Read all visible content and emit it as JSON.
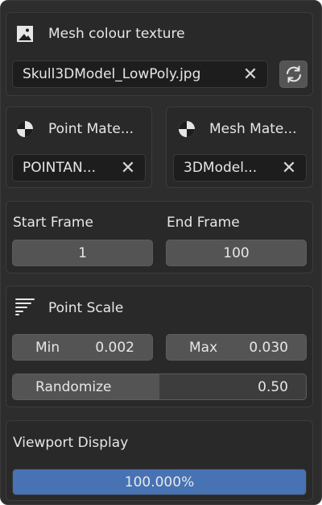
{
  "mesh_texture": {
    "title": "Mesh colour texture",
    "icon": "image-icon",
    "file_value": "Skull3DModel_LowPoly.jpg",
    "clear_glyph": "✕",
    "reload_icon": "refresh-icon"
  },
  "point_material": {
    "title": "Point Mate...",
    "icon": "material-sphere-icon",
    "value": "POINTAN...",
    "clear_glyph": "✕"
  },
  "mesh_material": {
    "title": "Mesh Mate...",
    "icon": "material-sphere-icon",
    "value": "3DModel...",
    "clear_glyph": "✕"
  },
  "frames": {
    "start_label": "Start Frame",
    "start_value": "1",
    "end_label": "End Frame",
    "end_value": "100"
  },
  "point_scale": {
    "title": "Point Scale",
    "icon": "scale-lines-icon",
    "min_label": "Min",
    "min_value": "0.002",
    "max_label": "Max",
    "max_value": "0.030",
    "randomize_label": "Randomize",
    "randomize_value": "0.50",
    "randomize_fraction": 0.5
  },
  "viewport": {
    "title": "Viewport Display",
    "value_text": "100.000%",
    "fraction": 1.0
  },
  "colors": {
    "progress_fill": "#4772b3",
    "button_bg": "#545454",
    "field_bg": "#1d1d1d"
  }
}
